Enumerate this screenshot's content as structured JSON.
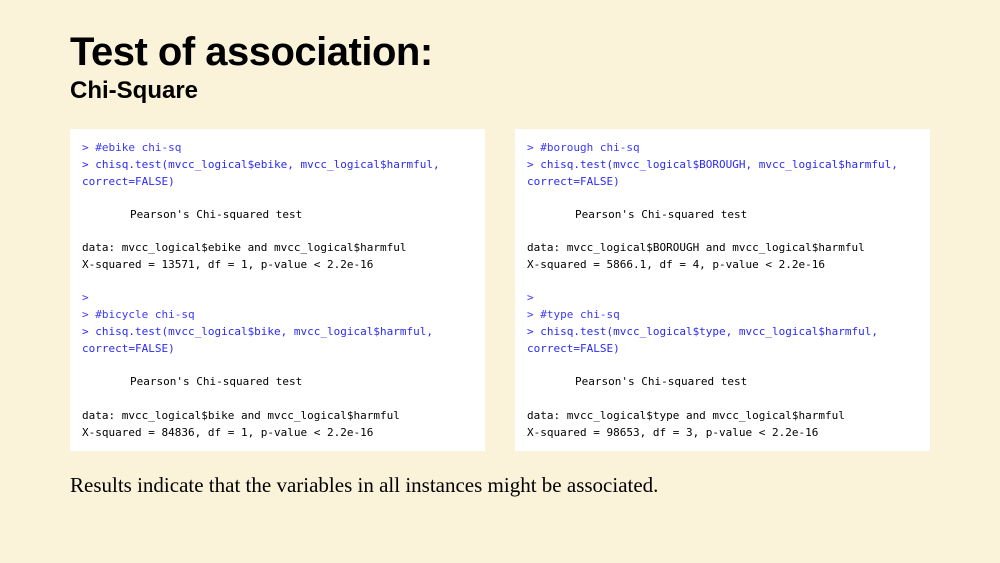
{
  "header": {
    "title": "Test of association:",
    "subtitle": "Chi-Square"
  },
  "left": {
    "t1_comment": "> #ebike chi-sq",
    "t1_call": "> chisq.test(mvcc_logical$ebike, mvcc_logical$harmful, correct=FALSE)",
    "t1_label": "Pearson's Chi-squared test",
    "t1_data": "data:  mvcc_logical$ebike and mvcc_logical$harmful",
    "t1_res": "X-squared = 13571, df = 1, p-value < 2.2e-16",
    "sep": ">",
    "t2_comment": "> #bicycle chi-sq",
    "t2_call": "> chisq.test(mvcc_logical$bike, mvcc_logical$harmful, correct=FALSE)",
    "t2_label": "Pearson's Chi-squared test",
    "t2_data": "data:  mvcc_logical$bike and mvcc_logical$harmful",
    "t2_res": "X-squared = 84836, df = 1, p-value < 2.2e-16"
  },
  "right": {
    "t1_comment": "> #borough chi-sq",
    "t1_call": "> chisq.test(mvcc_logical$BOROUGH, mvcc_logical$harmful, correct=FALSE)",
    "t1_label": "Pearson's Chi-squared test",
    "t1_data": "data:  mvcc_logical$BOROUGH and mvcc_logical$harmful",
    "t1_res": "X-squared = 5866.1, df = 4, p-value < 2.2e-16",
    "sep": ">",
    "t2_comment": "> #type chi-sq",
    "t2_call": "> chisq.test(mvcc_logical$type, mvcc_logical$harmful, correct=FALSE)",
    "t2_label": "Pearson's Chi-squared test",
    "t2_data": "data:  mvcc_logical$type and mvcc_logical$harmful",
    "t2_res": "X-squared = 98653, df = 3, p-value < 2.2e-16"
  },
  "conclusion": "Results indicate that the variables in all instances might be associated."
}
